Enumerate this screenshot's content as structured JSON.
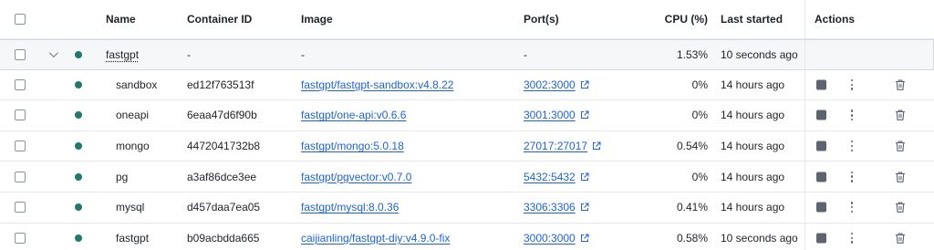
{
  "columns": {
    "name": "Name",
    "container_id": "Container ID",
    "image": "Image",
    "ports": "Port(s)",
    "cpu": "CPU (%)",
    "last_started": "Last started",
    "actions": "Actions"
  },
  "group": {
    "name": "fastgpt",
    "container_id": "-",
    "image": "-",
    "ports": "-",
    "cpu": "1.53%",
    "last_started": "10 seconds ago",
    "status_color": "#1f7a6a"
  },
  "containers": [
    {
      "name": "sandbox",
      "container_id": "ed12f763513f",
      "image": "fastgpt/fastgpt-sandbox:v4.8.22",
      "ports": "3002:3000",
      "cpu": "0%",
      "last_started": "14 hours ago"
    },
    {
      "name": "oneapi",
      "container_id": "6eaa47d6f90b",
      "image": "fastgpt/one-api:v0.6.6",
      "ports": "3001:3000",
      "cpu": "0%",
      "last_started": "14 hours ago"
    },
    {
      "name": "mongo",
      "container_id": "4472041732b8",
      "image": "fastgpt/mongo:5.0.18",
      "ports": "27017:27017",
      "cpu": "0.54%",
      "last_started": "14 hours ago"
    },
    {
      "name": "pg",
      "container_id": "a3af86dce3ee",
      "image": "fastgpt/pgvector:v0.7.0",
      "ports": "5432:5432",
      "cpu": "0%",
      "last_started": "14 hours ago"
    },
    {
      "name": "mysql",
      "container_id": "d457daa7ea05",
      "image": "fastgpt/mysql:8.0.36",
      "ports": "3306:3306",
      "cpu": "0.41%",
      "last_started": "14 hours ago"
    },
    {
      "name": "fastgpt",
      "container_id": "b09acbdda665",
      "image": "caijianling/fastgpt-diy:v4.9.0-fix",
      "ports": "3000:3000",
      "cpu": "0.58%",
      "last_started": "10 seconds ago"
    }
  ],
  "icons": {
    "status": "running-status-dot",
    "stop": "stop-icon",
    "more": "more-options-icon",
    "delete": "trash-icon",
    "port_link": "external-link-icon",
    "expand": "chevron-down-icon"
  },
  "colors": {
    "link": "#1d63d8",
    "status_running": "#1f7a6a",
    "group_background": "#f6f7f9"
  }
}
